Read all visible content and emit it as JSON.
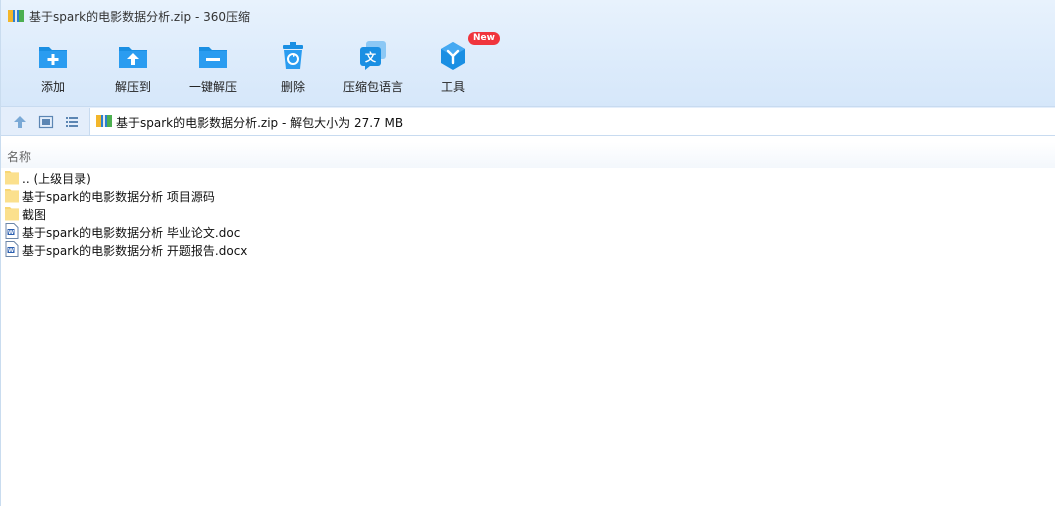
{
  "window": {
    "title": "基于spark的电影数据分析.zip - 360压缩"
  },
  "toolbar": {
    "items": [
      {
        "label": "添加",
        "icon": "add-file-icon"
      },
      {
        "label": "解压到",
        "icon": "extract-to-icon"
      },
      {
        "label": "一键解压",
        "icon": "one-click-extract-icon"
      },
      {
        "label": "删除",
        "icon": "delete-icon"
      },
      {
        "label": "压缩包语言",
        "icon": "archive-language-icon"
      },
      {
        "label": "工具",
        "icon": "tools-icon",
        "badge": "New"
      }
    ]
  },
  "address": {
    "text": "基于spark的电影数据分析.zip - 解包大小为 27.7 MB"
  },
  "columns": {
    "name": "名称"
  },
  "files": [
    {
      "name": ".. (上级目录)",
      "type": "folder"
    },
    {
      "name": "基于spark的电影数据分析 项目源码",
      "type": "folder"
    },
    {
      "name": "截图",
      "type": "folder"
    },
    {
      "name": "基于spark的电影数据分析 毕业论文.doc",
      "type": "doc"
    },
    {
      "name": "基于spark的电影数据分析 开题报告.docx",
      "type": "doc"
    }
  ],
  "colors": {
    "accent": "#1a8fe3",
    "badge": "#f0353d",
    "folder": "#f8d775"
  }
}
